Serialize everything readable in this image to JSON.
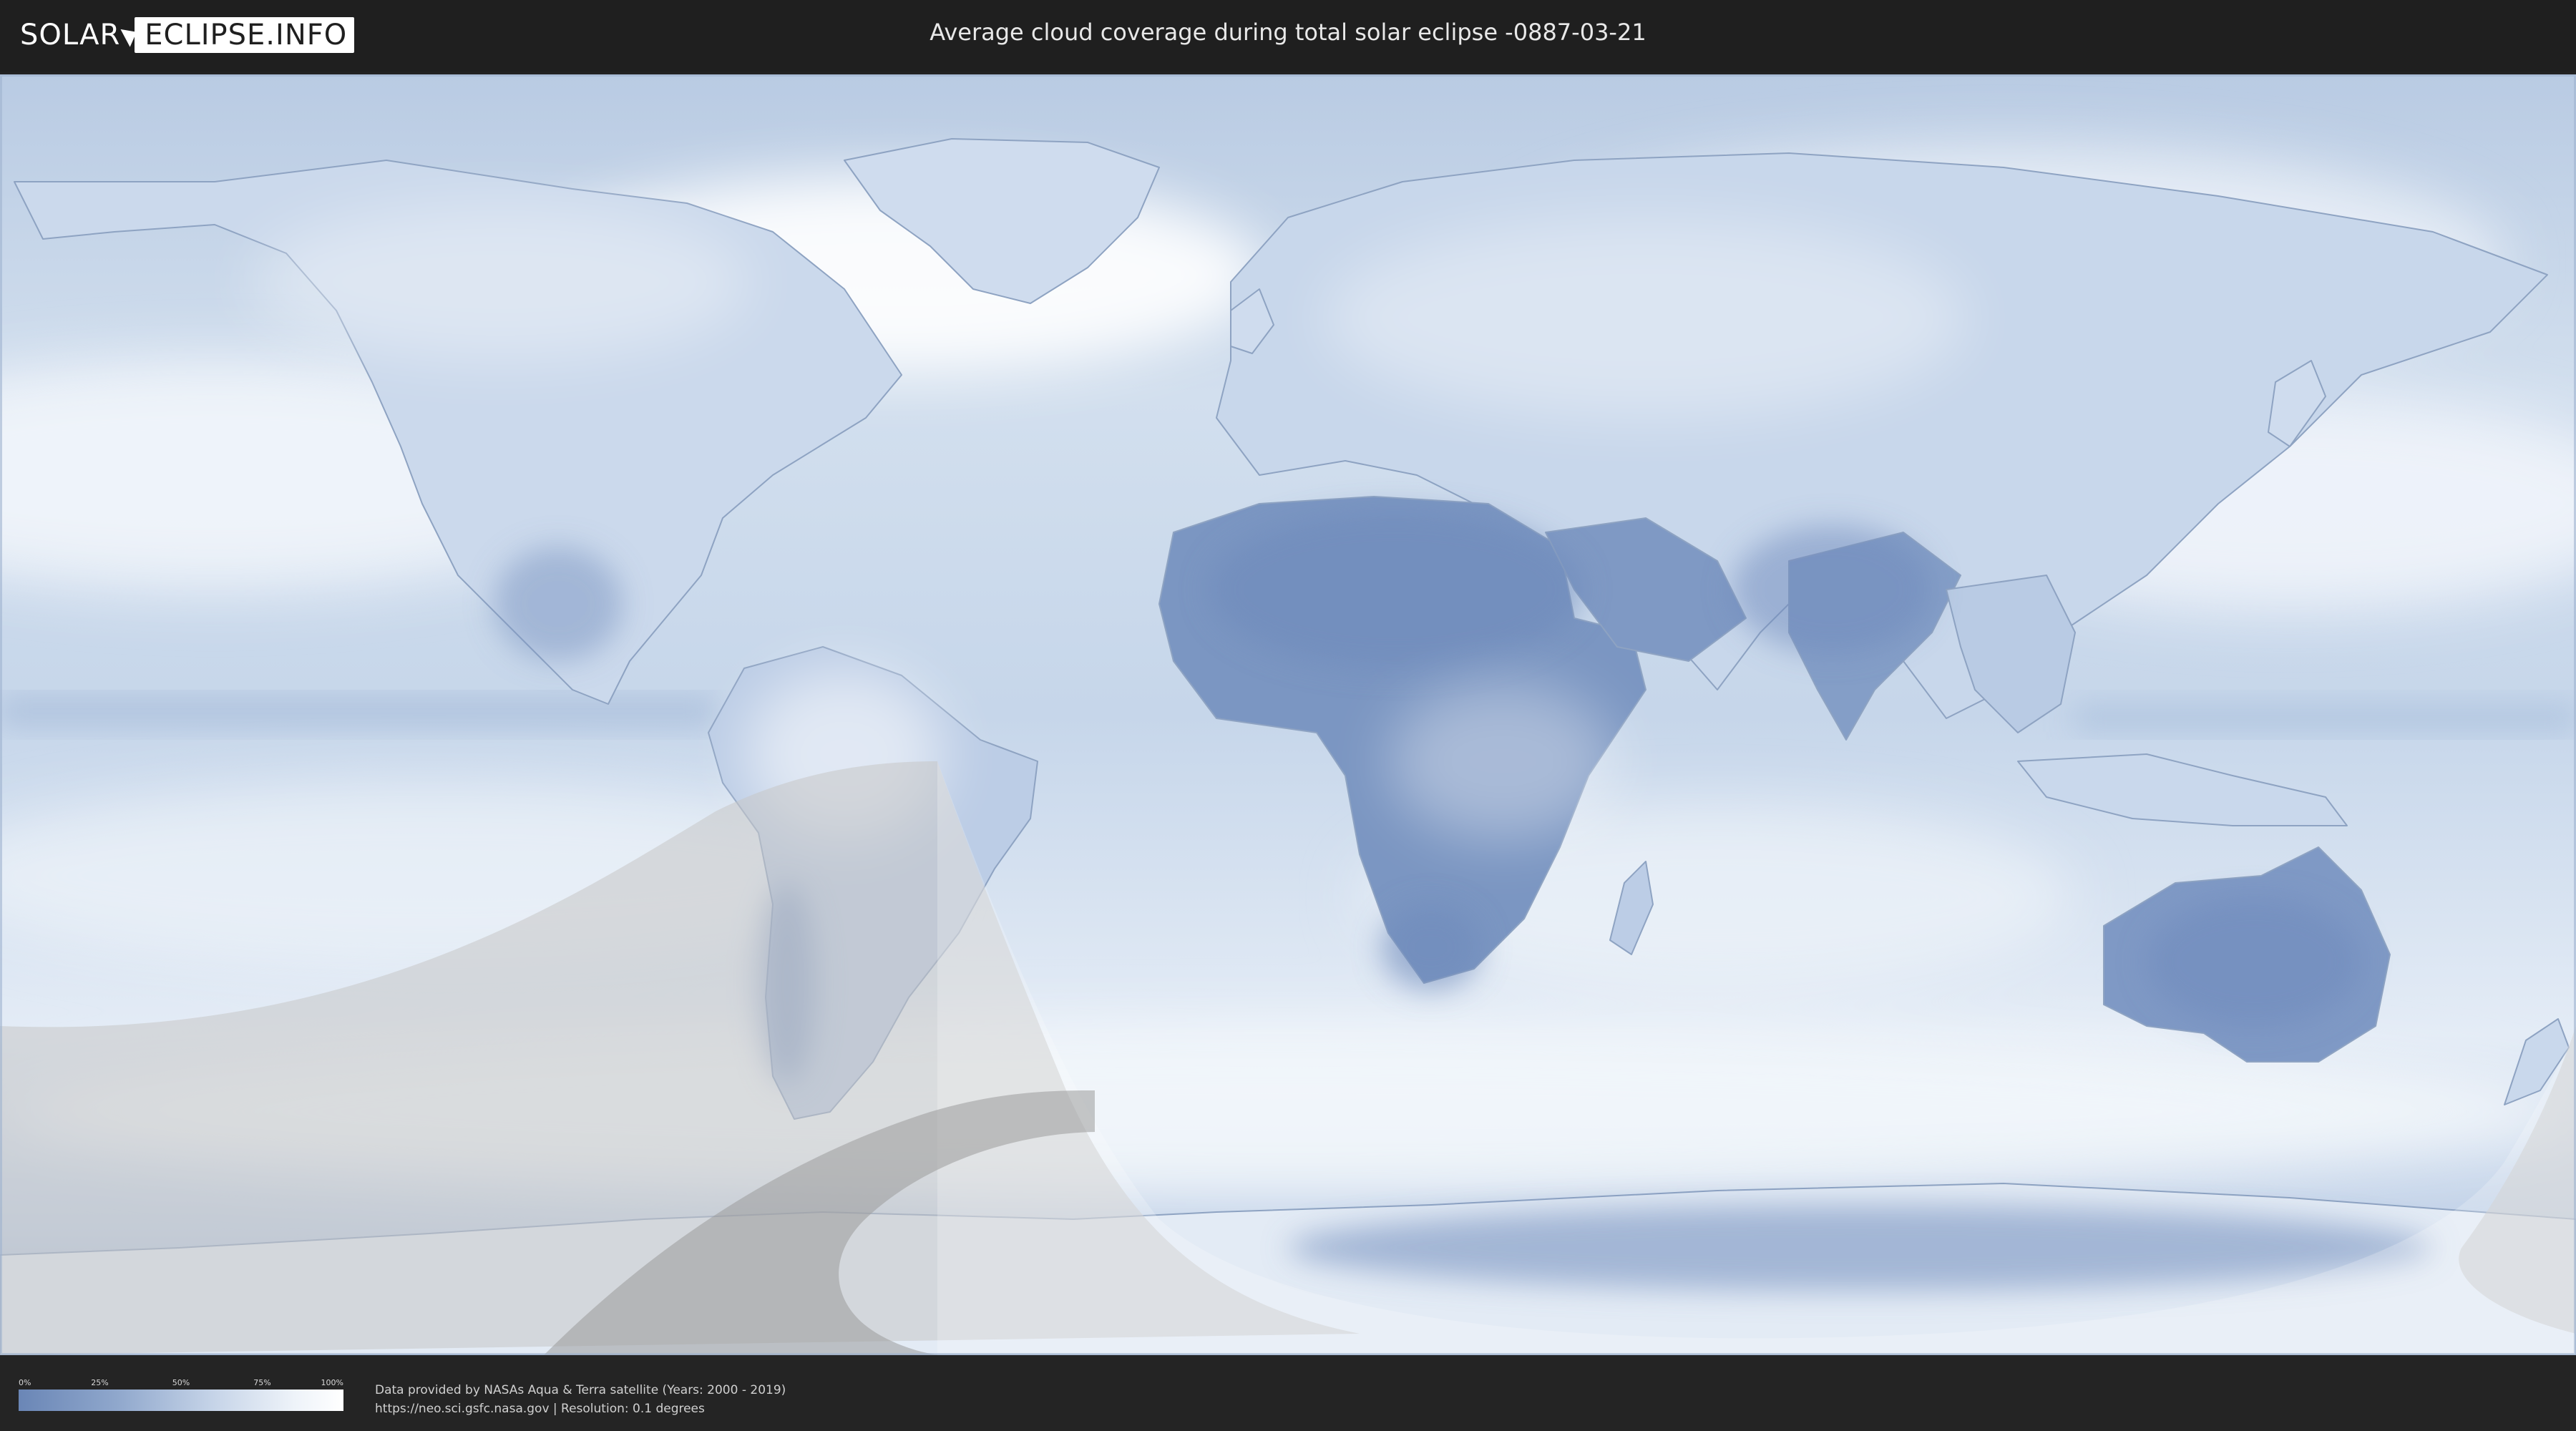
{
  "header": {
    "logo_word1": "SOLAR",
    "logo_word2": "ECLIPSE.INFO",
    "title": "Average cloud coverage during total solar eclipse -0887-03-21"
  },
  "legend": {
    "ticks": [
      "0%",
      "25%",
      "50%",
      "75%",
      "100%"
    ],
    "color_low": "#6a86b6",
    "color_high": "#ffffff"
  },
  "footer": {
    "credit_line1": "Data provided by NASAs Aqua & Terra satellite (Years: 2000 - 2019)",
    "credit_line2": "https://neo.sci.gsfc.nasa.gov | Resolution: 0.1 degrees"
  },
  "map": {
    "projection": "equirectangular",
    "ocean_color": "#c9d8ea",
    "land_clear_color": "#6f8cbc",
    "cloud_color": "#ffffff",
    "eclipse_overlay_color": "#c8c8c8"
  }
}
